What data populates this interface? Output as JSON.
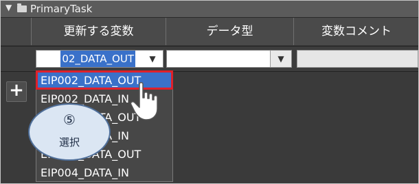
{
  "title_bar": {
    "label": "PrimaryTask",
    "expand_icon": "triangle-down"
  },
  "columns": [
    {
      "label": "更新する変数"
    },
    {
      "label": "データ型"
    },
    {
      "label": "変数コメント"
    }
  ],
  "edit_row": {
    "variable_value": "02_DATA_OUT",
    "data_type_value": "",
    "comment_value": ""
  },
  "add_button": {
    "label": "+"
  },
  "dropdown": {
    "items": [
      "EIP002_DATA_OUT",
      "EIP002_DATA_IN",
      "EIP003_DATA_OUT",
      "EIP003_DATA_IN",
      "EIP004_DATA_OUT",
      "EIP004_DATA_IN"
    ],
    "selected_index": 0
  },
  "annotation": {
    "number": "⑤",
    "text": "選択"
  },
  "colors": {
    "selection": "#3a71c9",
    "highlight_border": "#e0202a",
    "callout_fill": "#dbe6f3"
  }
}
